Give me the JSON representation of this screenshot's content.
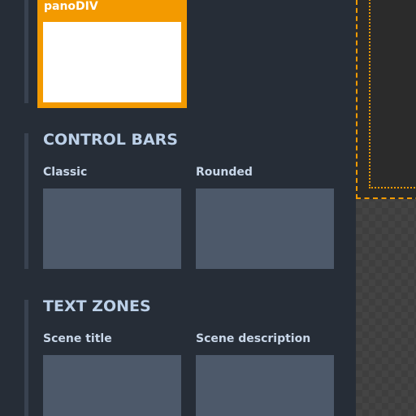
{
  "colors": {
    "panel_bg": "#262d37",
    "accent": "#f39a00",
    "tile_bg": "#4d596a",
    "section_title": "#bcd0e8"
  },
  "panodiv": {
    "label": "panoDIV"
  },
  "control_bars": {
    "title": "CONTROL BARS",
    "items": [
      {
        "label": "Classic"
      },
      {
        "label": "Rounded"
      }
    ]
  },
  "text_zones": {
    "title": "TEXT ZONES",
    "items": [
      {
        "label": "Scene title"
      },
      {
        "label": "Scene description"
      }
    ]
  }
}
